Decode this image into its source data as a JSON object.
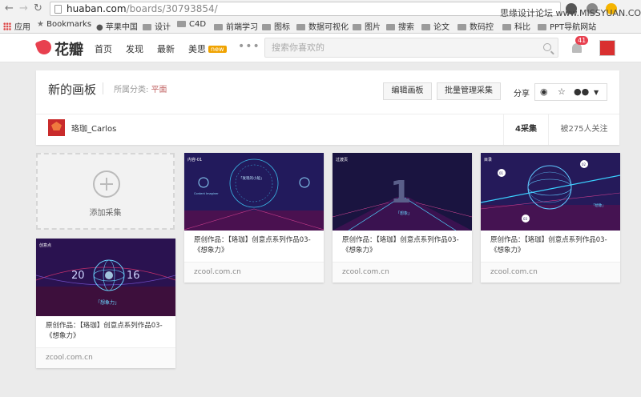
{
  "browser": {
    "url_host": "huaban.com",
    "url_path": "/boards/30793854/",
    "watermark": "思缘设计论坛 www.MISSYUAN.COM",
    "bookmarks": [
      "应用",
      "Bookmarks",
      "苹果中国",
      "设计",
      "C4D",
      "前端学习",
      "图标",
      "数据可视化",
      "图片",
      "搜索",
      "论文",
      "数码控",
      "科比",
      "PPT导航网站"
    ]
  },
  "site": {
    "logo": "花瓣",
    "nav": [
      "首页",
      "发现",
      "最新",
      "美思"
    ],
    "nav_badge": "new",
    "search_placeholder": "搜索你喜欢的",
    "notifications": "41"
  },
  "board": {
    "title": "新的画板",
    "category_label": "所属分类:",
    "category": "平面",
    "edit_button": "编辑画板",
    "manage_button": "批量管理采集",
    "share_label": "分享",
    "owner": "珞珈_Carlos",
    "pin_count": "4采集",
    "followers": "被275人关注"
  },
  "add_pin": {
    "label": "添加采集"
  },
  "pins": [
    {
      "caption": "原创作品：【珞珈】创意点系列作品03-《想象力》",
      "source": "zcool.com.cn",
      "thumb_text": [
        "创意点",
        "20",
        "16",
        "「想象力」"
      ]
    },
    {
      "caption": "原创作品：【珞珈】创意点系列作品03-《想象力》",
      "source": "zcool.com.cn",
      "thumb_text": [
        "内容-01",
        "「发现的小船」",
        "Content Imaginer"
      ]
    },
    {
      "caption": "原创作品：【珞珈】创意点系列作品03-《想象力》",
      "source": "zcool.com.cn",
      "thumb_text": [
        "过渡页",
        "1",
        "「想象」"
      ]
    },
    {
      "caption": "原创作品：【珞珈】创意点系列作品03-《想象力》",
      "source": "zcool.com.cn",
      "thumb_text": [
        "目录",
        "01",
        "02",
        "03",
        "「想象」"
      ]
    }
  ],
  "colors": {
    "brand": "#e8404f",
    "category": "#c06060",
    "thumb_bg": "#2a1250"
  }
}
